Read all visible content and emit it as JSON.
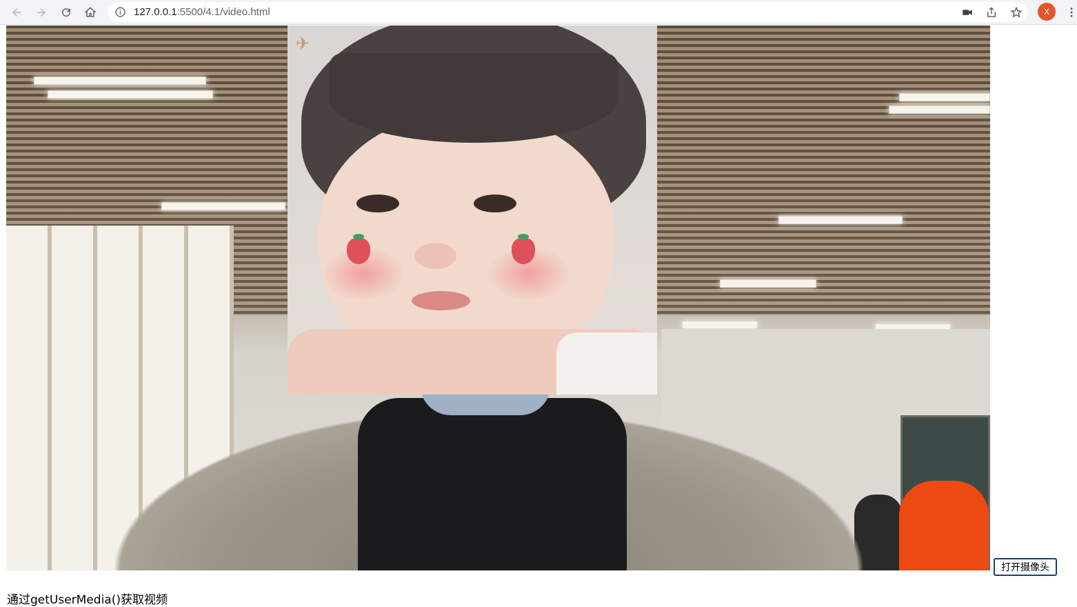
{
  "browser": {
    "url_host": "127.0.0.1",
    "url_rest": ":5500/4.1/video.html",
    "avatar_letter": "X",
    "icons": {
      "back": "back-arrow-icon",
      "forward": "forward-arrow-icon",
      "reload": "reload-icon",
      "home": "home-icon",
      "info": "info-icon",
      "camera": "camera-icon",
      "share": "share-icon",
      "bookmark": "star-icon",
      "menu": "kebab-menu-icon"
    }
  },
  "page": {
    "open_camera_label": "打开摄像头",
    "caption": "通过getUserMedia()获取视频"
  },
  "colors": {
    "toolbar_bg": "#f1f3f4",
    "avatar_bg": "#e8542a",
    "button_border": "#1a3e74"
  }
}
